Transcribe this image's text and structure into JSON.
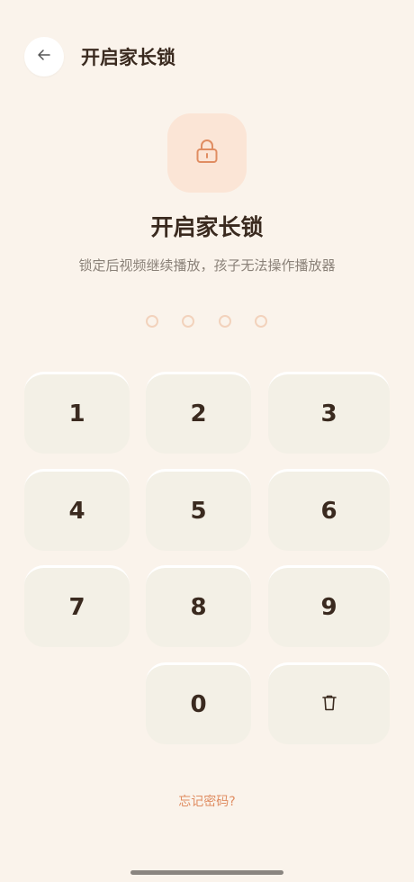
{
  "header": {
    "title": "开启家长锁"
  },
  "hero": {
    "title": "开启家长锁",
    "subtitle": "锁定后视频继续播放，孩子无法操作播放器"
  },
  "pin": {
    "length": 4,
    "filled": 0
  },
  "keypad": {
    "keys": [
      "1",
      "2",
      "3",
      "4",
      "5",
      "6",
      "7",
      "8",
      "9",
      "0"
    ],
    "delete_icon": "trash-icon"
  },
  "footer": {
    "forgot_label": "忘记密码?"
  },
  "colors": {
    "background": "#faf3eb",
    "accent": "#e08d62",
    "key_background": "#f3f0e6",
    "lock_tile": "#fbe5d6",
    "dot_border": "#f2d2bc",
    "title_text": "#3a2a1f",
    "subtitle_text": "#8a8178"
  }
}
